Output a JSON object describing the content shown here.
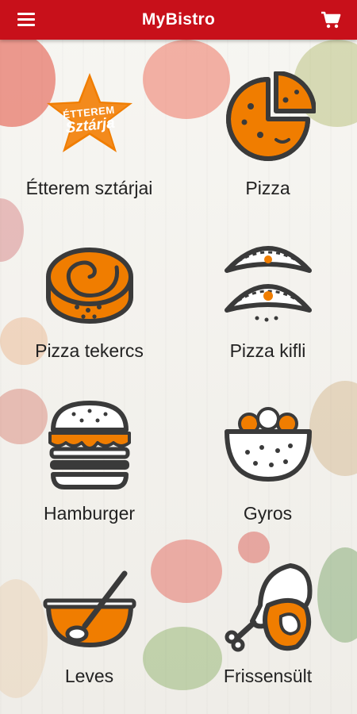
{
  "app": {
    "title": "MyBistro"
  },
  "icons": {
    "menu": "hamburger-menu-icon",
    "cart": "shopping-cart-icon"
  },
  "colors": {
    "appbar": "#c8101a",
    "accent": "#f07d00",
    "outline": "#3a3a3a"
  },
  "badge": {
    "line1": "ÉTTEREM",
    "line2": "Sztárja"
  },
  "categories": [
    {
      "label": "Étterem sztárjai",
      "icon": "restaurant-star-badge-icon"
    },
    {
      "label": "Pizza",
      "icon": "pizza-icon"
    },
    {
      "label": "Pizza tekercs",
      "icon": "pizza-roll-icon"
    },
    {
      "label": "Pizza kifli",
      "icon": "pizza-kifli-icon"
    },
    {
      "label": "Hamburger",
      "icon": "hamburger-icon"
    },
    {
      "label": "Gyros",
      "icon": "gyros-bowl-icon"
    },
    {
      "label": "Leves",
      "icon": "soup-bowl-icon"
    },
    {
      "label": "Frissensült",
      "icon": "chicken-leg-steak-icon"
    }
  ]
}
